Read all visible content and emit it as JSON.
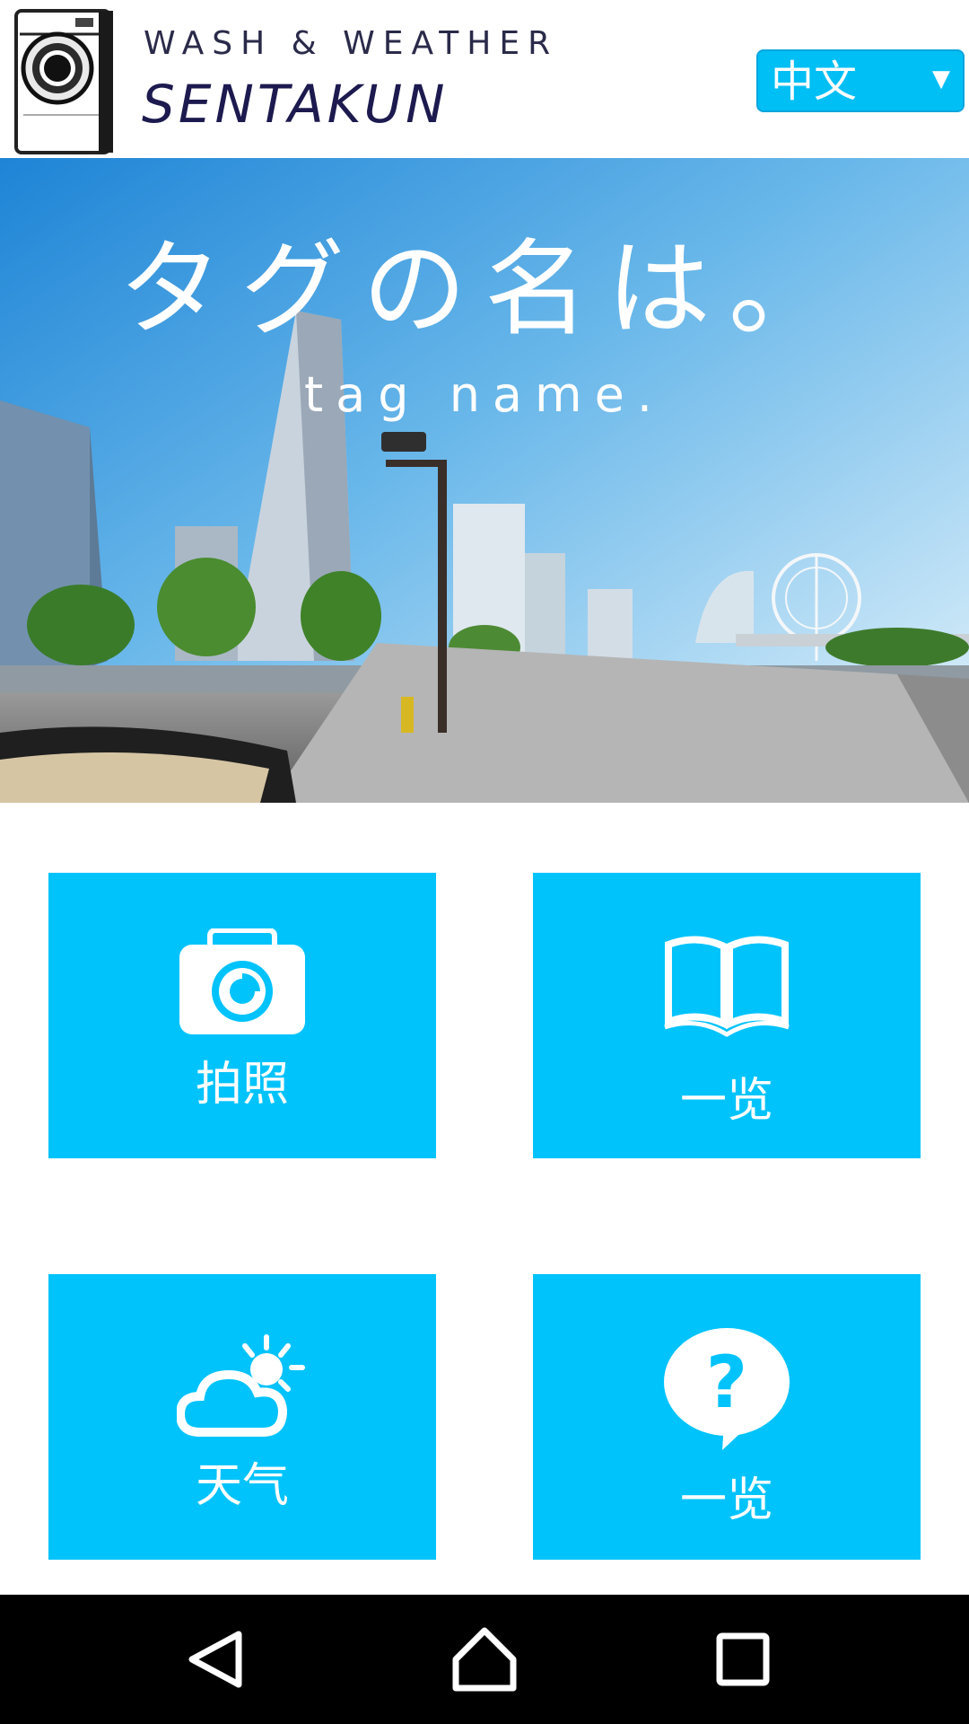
{
  "app": {
    "brand_tagline": "WASH & WEATHER",
    "brand_name": "SENTAKUN"
  },
  "language": {
    "selected": "中文",
    "caret": "▼"
  },
  "hero": {
    "title": "タグの名は。",
    "subtitle": "tag name."
  },
  "tiles": [
    {
      "label": "拍照",
      "icon": "camera-icon"
    },
    {
      "label": "一览",
      "icon": "open-book-icon"
    },
    {
      "label": "天气",
      "icon": "cloud-sun-icon"
    },
    {
      "label": "一览",
      "icon": "question-bubble-icon"
    }
  ],
  "navigation": {
    "back": "back-icon",
    "home": "home-icon",
    "recents": "recents-icon"
  },
  "colors": {
    "accent": "#00c3fb",
    "navbar": "#000000",
    "brand_text": "#1c1a4e"
  }
}
